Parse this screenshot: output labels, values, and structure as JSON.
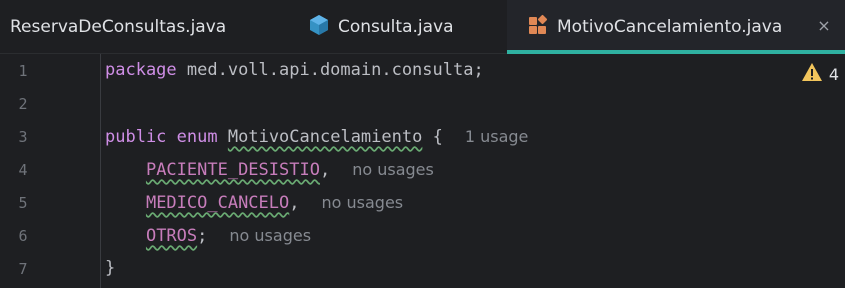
{
  "tabs": [
    {
      "label": "ReservaDeConsultas.java",
      "icon": "java-class-icon",
      "active": false
    },
    {
      "label": "Consulta.java",
      "icon": "record-icon",
      "active": false
    },
    {
      "label": "MotivoCancelamiento.java",
      "icon": "enum-icon",
      "active": true
    }
  ],
  "tab_close_symbol": "×",
  "editor": {
    "line_numbers": [
      "1",
      "2",
      "3",
      "4",
      "5",
      "6",
      "7"
    ],
    "lines": {
      "l1": {
        "keyword": "package",
        "text": " med.voll.api.domain.consulta;"
      },
      "l3": {
        "kw1": "public",
        "kw2": "enum",
        "name": "MotivoCancelamiento",
        "brace": " {",
        "hint": "1 usage"
      },
      "l4": {
        "const": "PACIENTE_DESISTIO",
        "punct": ",",
        "hint": "no usages"
      },
      "l5": {
        "const": "MEDICO_CANCELO",
        "punct": ",",
        "hint": "no usages"
      },
      "l6": {
        "const": "OTROS",
        "punct": ";",
        "hint": "no usages"
      },
      "l7": {
        "text": "}"
      }
    },
    "warnings_count": "4"
  },
  "colors": {
    "active_tab_underline": "#2fb1a1",
    "keyword": "#cf8ee6",
    "constant": "#c77dbb",
    "warning": "#f2c55c"
  }
}
